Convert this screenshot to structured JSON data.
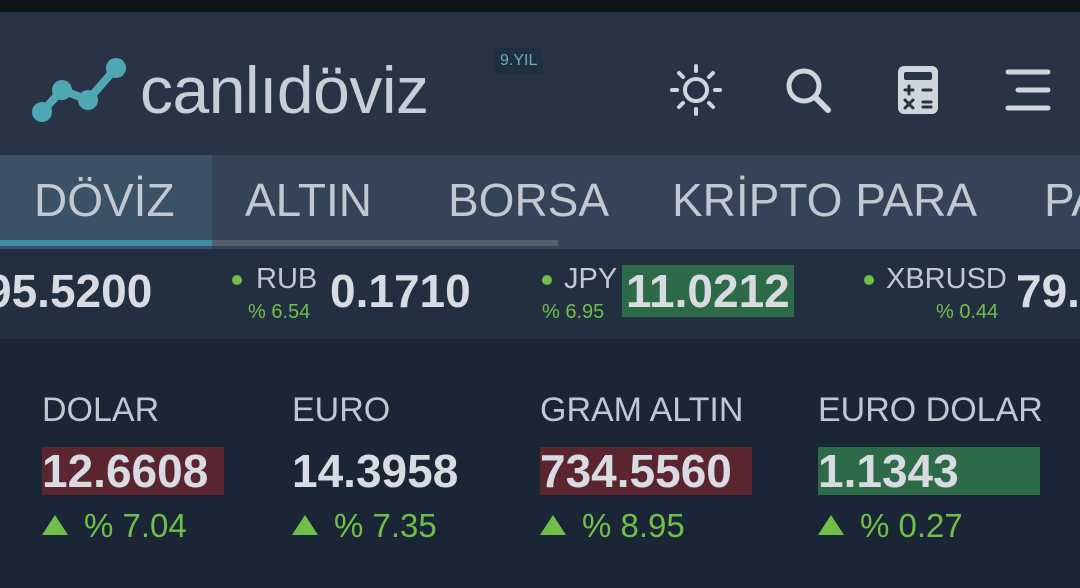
{
  "header": {
    "brand": "canlıdöviz",
    "badge": "9.YIL",
    "icons": [
      "sun-icon",
      "search-icon",
      "calculator-icon",
      "menu-icon"
    ]
  },
  "nav": {
    "tabs": [
      {
        "label": "DÖVİZ",
        "active": true
      },
      {
        "label": "ALTIN",
        "active": false
      },
      {
        "label": "BORSA",
        "active": false
      },
      {
        "label": "KRİPTO PARA",
        "active": false
      },
      {
        "label": "PA",
        "active": false
      }
    ]
  },
  "ticker": [
    {
      "symbol": "",
      "pct": "",
      "value": "95.5200"
    },
    {
      "symbol": "RUB",
      "pct": "% 6.54",
      "value": "0.1710"
    },
    {
      "symbol": "JPY",
      "pct": "% 6.95",
      "value": "11.0212"
    },
    {
      "symbol": "XBRUSD",
      "pct": "% 0.44",
      "value": "79."
    }
  ],
  "cards": [
    {
      "name": "DOLAR",
      "value": "12.6608",
      "change": "% 7.04",
      "highlight": "red"
    },
    {
      "name": "EURO",
      "value": "14.3958",
      "change": "% 7.35",
      "highlight": "none"
    },
    {
      "name": "GRAM ALTIN",
      "value": "734.5560",
      "change": "% 8.95",
      "highlight": "red"
    },
    {
      "name": "EURO DOLAR",
      "value": "1.1343",
      "change": "% 0.27",
      "highlight": "green"
    }
  ],
  "colors": {
    "up": "#6fbf49",
    "highlight_red": "#5b2530",
    "highlight_green": "#2d6a47",
    "accent": "#3b8fa0"
  }
}
